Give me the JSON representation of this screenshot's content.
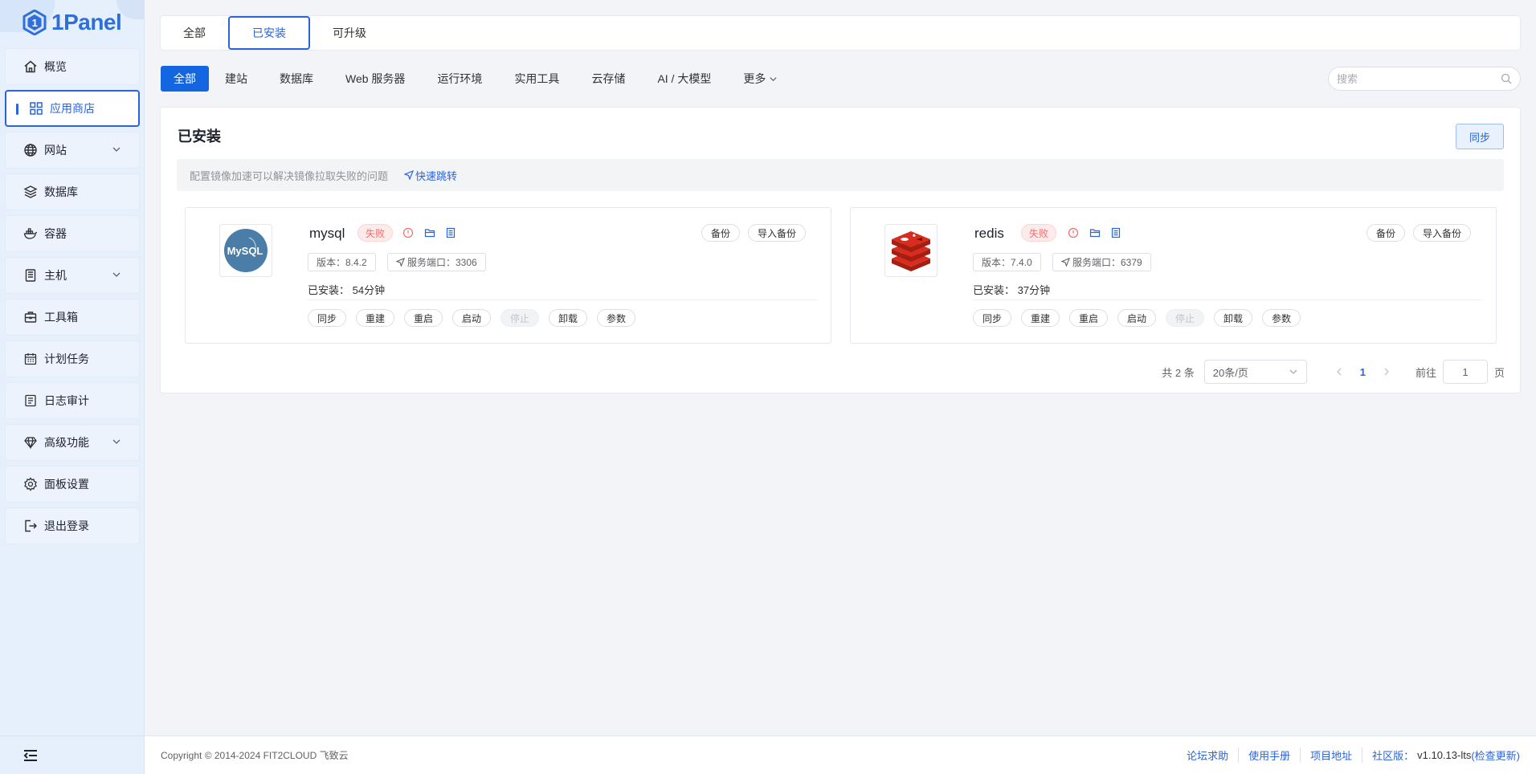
{
  "brand": {
    "name": "1Panel"
  },
  "sidebar": {
    "items": [
      {
        "label": "概览",
        "icon": "home-icon"
      },
      {
        "label": "应用商店",
        "icon": "grid-icon"
      },
      {
        "label": "网站",
        "icon": "globe-icon"
      },
      {
        "label": "数据库",
        "icon": "layers-icon"
      },
      {
        "label": "容器",
        "icon": "docker-icon"
      },
      {
        "label": "主机",
        "icon": "server-icon"
      },
      {
        "label": "工具箱",
        "icon": "toolbox-icon"
      },
      {
        "label": "计划任务",
        "icon": "calendar-icon"
      },
      {
        "label": "日志审计",
        "icon": "log-icon"
      },
      {
        "label": "高级功能",
        "icon": "diamond-icon"
      },
      {
        "label": "面板设置",
        "icon": "gear-icon"
      },
      {
        "label": "退出登录",
        "icon": "logout-icon"
      }
    ],
    "active_index": 1
  },
  "top_tabs": {
    "all": "全部",
    "installed": "已安装",
    "upgradable": "可升级"
  },
  "categories": {
    "all": "全部",
    "website": "建站",
    "database": "数据库",
    "web_server": "Web 服务器",
    "runtime": "运行环境",
    "tools": "实用工具",
    "storage": "云存储",
    "ai": "AI / 大模型",
    "more": "更多"
  },
  "search": {
    "placeholder": "搜索"
  },
  "panel": {
    "title": "已安装",
    "sync_label": "同步",
    "notice": "配置镜像加速可以解决镜像拉取失败的问题",
    "notice_link": "快速跳转"
  },
  "apps": [
    {
      "name": "mysql",
      "status": "失败",
      "version": "版本：8.4.2",
      "port": "服务端口：3306",
      "installed": "已安装：  54分钟",
      "backup": "备份",
      "import_backup": "导入备份",
      "actions": [
        "同步",
        "重建",
        "重启",
        "启动",
        "停止",
        "卸载",
        "参数"
      ],
      "disabled_action": "停止",
      "logo_text": "MySQL"
    },
    {
      "name": "redis",
      "status": "失败",
      "version": "版本：7.4.0",
      "port": "服务端口：6379",
      "installed": "已安装：  37分钟",
      "backup": "备份",
      "import_backup": "导入备份",
      "actions": [
        "同步",
        "重建",
        "重启",
        "启动",
        "停止",
        "卸载",
        "参数"
      ],
      "disabled_action": "停止"
    }
  ],
  "pagination": {
    "total": "共 2 条",
    "page_size": "20条/页",
    "current_page": "1",
    "goto_label": "前往",
    "goto_value": "1",
    "page_suffix": "页"
  },
  "footer": {
    "copyright": "Copyright © 2014-2024 FIT2CLOUD 飞致云",
    "forum": "论坛求助",
    "manual": "使用手册",
    "project": "项目地址",
    "edition": "社区版：",
    "version": "v1.10.13-lts",
    "check_update": "(检查更新)"
  },
  "colors": {
    "primary": "#2b63d9",
    "danger": "#f56c6c",
    "sidebar_bg": "#e6effc"
  }
}
